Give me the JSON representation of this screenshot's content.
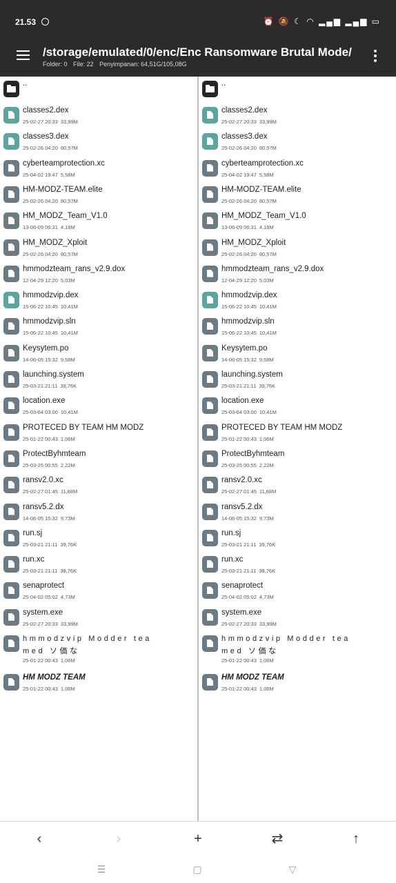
{
  "status_bar": {
    "time": "21.53",
    "icons": [
      "whatsapp-icon",
      "alarm-icon",
      "mute-icon",
      "moon-icon",
      "wifi-icon",
      "signal-icon",
      "signal-icon",
      "battery-icon"
    ]
  },
  "app_bar": {
    "path": "/storage/emulated/0/enc/Enc Ransomware Brutal Mode/",
    "folder_count": "Folder: 0",
    "file_count": "File: 22",
    "storage": "Penyimpanan: 64,51G/105,08G"
  },
  "parent_item": "..",
  "files": [
    {
      "name": "classes2.dex",
      "date": "25-02-27 20:33",
      "size": "33,99M",
      "type": "dex"
    },
    {
      "name": "classes3.dex",
      "date": "25-02-26 04:20",
      "size": "80,57M",
      "type": "dex"
    },
    {
      "name": "cyberteamprotection.xc",
      "date": "25-04-02 19:47",
      "size": "5,58M",
      "type": "file"
    },
    {
      "name": "HM-MODZ-TEAM.elite",
      "date": "25-02-26 04:20",
      "size": "80,57M",
      "type": "file"
    },
    {
      "name": "HM_MODZ_Team_V1.0",
      "date": "13-06-09 06:31",
      "size": "4,18M",
      "type": "file"
    },
    {
      "name": "HM_MODZ_Xploit",
      "date": "25-02-26 04:20",
      "size": "80,57M",
      "type": "file"
    },
    {
      "name": "hmmodzteam_rans_v2.9.dox",
      "date": "12-04-29 12:20",
      "size": "5,03M",
      "type": "file"
    },
    {
      "name": "hmmodzvip.dex",
      "date": "15-06-22 10:45",
      "size": "10,41M",
      "type": "dex"
    },
    {
      "name": "hmmodzvip.sln",
      "date": "15-06-22 10:45",
      "size": "10,41M",
      "type": "file"
    },
    {
      "name": "Keysytem.po",
      "date": "14-06-05 15:32",
      "size": "9,58M",
      "type": "file"
    },
    {
      "name": "launching.system",
      "date": "25-03-21 21:11",
      "size": "39,76K",
      "type": "file"
    },
    {
      "name": "location.exe",
      "date": "25-03-04 03:00",
      "size": "10,41M",
      "type": "file"
    },
    {
      "name": "PROTECED BY TEAM HM MODZ",
      "date": "25-01-22 00:43",
      "size": "1,06M",
      "type": "file"
    },
    {
      "name": "ProtectByhmteam",
      "date": "25-03-25 00:55",
      "size": "2,22M",
      "type": "file"
    },
    {
      "name": "ransv2.0.xc",
      "date": "25-02-27 01:45",
      "size": "11,68M",
      "type": "file"
    },
    {
      "name": "ransv5.2.dx",
      "date": "14-06-05 15:32",
      "size": "9,73M",
      "type": "file"
    },
    {
      "name": "run.sj",
      "date": "25-03-21 21:11",
      "size": "39,76K",
      "type": "file"
    },
    {
      "name": "run.xc",
      "date": "25-03-21 21:11",
      "size": "39,76K",
      "type": "file"
    },
    {
      "name": "senaprotect",
      "date": "25-04-02 05:02",
      "size": "4,73M",
      "type": "file"
    },
    {
      "name": "system.exe",
      "date": "25-02-27 20:33",
      "size": "33,99M",
      "type": "file"
    },
    {
      "name": "hmmodzvip Modder tea",
      "name_line2": "med ソ価な",
      "date": "25-01-22 00:43",
      "size": "1,06M",
      "type": "file",
      "style": "spaced"
    },
    {
      "name": "HM MODZ TEAM",
      "date": "25-01-22 00:43",
      "size": "1,06M",
      "type": "file",
      "style": "bold"
    }
  ],
  "bottom_bar": {
    "buttons": [
      {
        "icon": "back-arrow-icon",
        "glyph": "‹",
        "enabled": true
      },
      {
        "icon": "forward-arrow-icon",
        "glyph": "›",
        "enabled": false
      },
      {
        "icon": "add-icon",
        "glyph": "+",
        "enabled": true
      },
      {
        "icon": "swap-panes-icon",
        "glyph": "⇄",
        "enabled": true
      },
      {
        "icon": "up-directory-icon",
        "glyph": "↑",
        "enabled": true
      }
    ]
  },
  "nav_bar": {
    "buttons": [
      {
        "icon": "recents-icon",
        "glyph": "☰"
      },
      {
        "icon": "home-icon",
        "glyph": "▢"
      },
      {
        "icon": "back-triangle-icon",
        "glyph": "▽"
      }
    ]
  }
}
